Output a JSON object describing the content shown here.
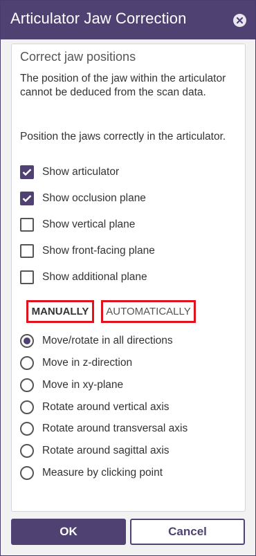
{
  "window": {
    "title": "Articulator Jaw Correction"
  },
  "panel": {
    "section_title": "Correct jaw positions",
    "description_1": "The position of the jaw within the articulator cannot be deduced from the scan data.",
    "description_2": "Position the jaws correctly in the articulator.",
    "checkboxes": [
      {
        "label": "Show articulator",
        "checked": true
      },
      {
        "label": "Show occlusion plane",
        "checked": true
      },
      {
        "label": "Show vertical plane",
        "checked": false
      },
      {
        "label": "Show front-facing plane",
        "checked": false
      },
      {
        "label": "Show additional plane",
        "checked": false
      }
    ],
    "tabs": {
      "manual": "MANUALLY",
      "automatic": "AUTOMATICALLY",
      "selected": "manual"
    },
    "radio_options": [
      {
        "label": "Move/rotate in all directions",
        "selected": true
      },
      {
        "label": "Move in z-direction",
        "selected": false
      },
      {
        "label": "Move in xy-plane",
        "selected": false
      },
      {
        "label": "Rotate around vertical axis",
        "selected": false
      },
      {
        "label": "Rotate around transversal axis",
        "selected": false
      },
      {
        "label": "Rotate around sagittal axis",
        "selected": false
      },
      {
        "label": "Measure by clicking point",
        "selected": false
      }
    ]
  },
  "buttons": {
    "ok": "OK",
    "cancel": "Cancel"
  },
  "colors": {
    "accent": "#4f4273",
    "highlight_border": "#e0131d"
  }
}
